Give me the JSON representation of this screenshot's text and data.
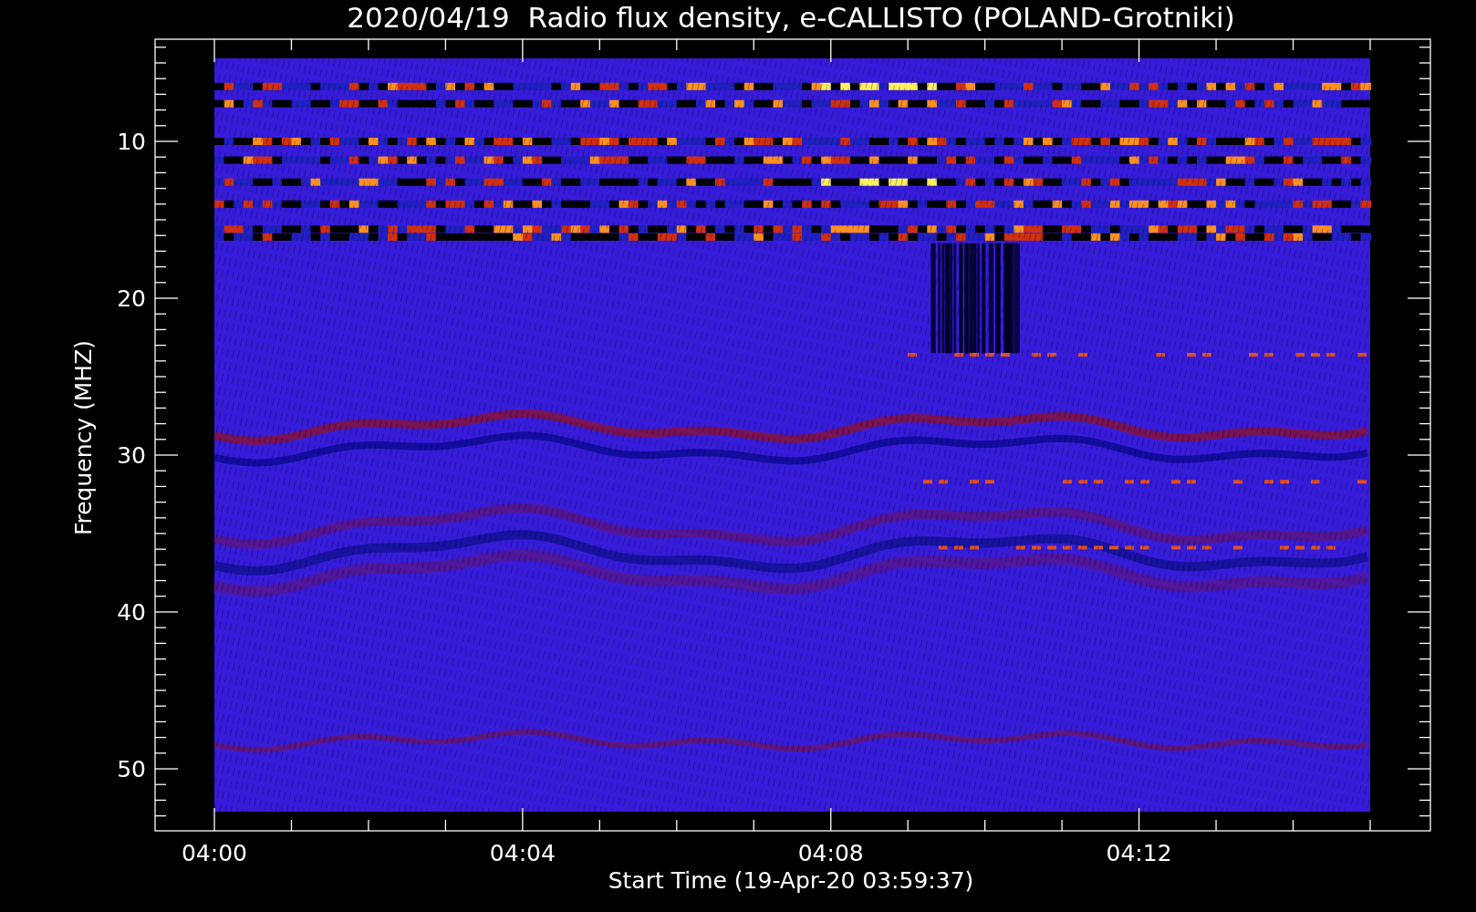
{
  "title": "2020/04/19  Radio flux density, e-CALLISTO (POLAND-Grotniki)",
  "y_axis": {
    "label": "Frequency (MHZ)",
    "ticks": [
      "10",
      "20",
      "30",
      "40",
      "50"
    ]
  },
  "x_axis": {
    "label": "Start Time (19-Apr-20 03:59:37)",
    "ticks": [
      "04:00",
      "04:04",
      "04:08",
      "04:12"
    ]
  }
}
